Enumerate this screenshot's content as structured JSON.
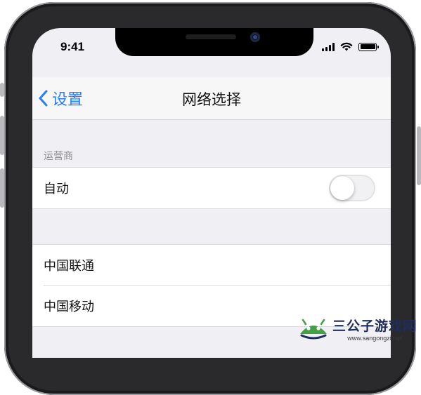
{
  "status_bar": {
    "time": "9:41"
  },
  "navbar": {
    "back_label": "设置",
    "title": "网络选择"
  },
  "section": {
    "header": "运营商"
  },
  "auto_row": {
    "label": "自动",
    "toggle_on": false
  },
  "carriers": [
    {
      "label": "中国联通"
    },
    {
      "label": "中国移动"
    }
  ],
  "watermark": {
    "title": "三公子游戏网",
    "url": "www.sangongzi.net"
  },
  "colors": {
    "accent": "#2c7cf6",
    "background": "#efeff4"
  }
}
